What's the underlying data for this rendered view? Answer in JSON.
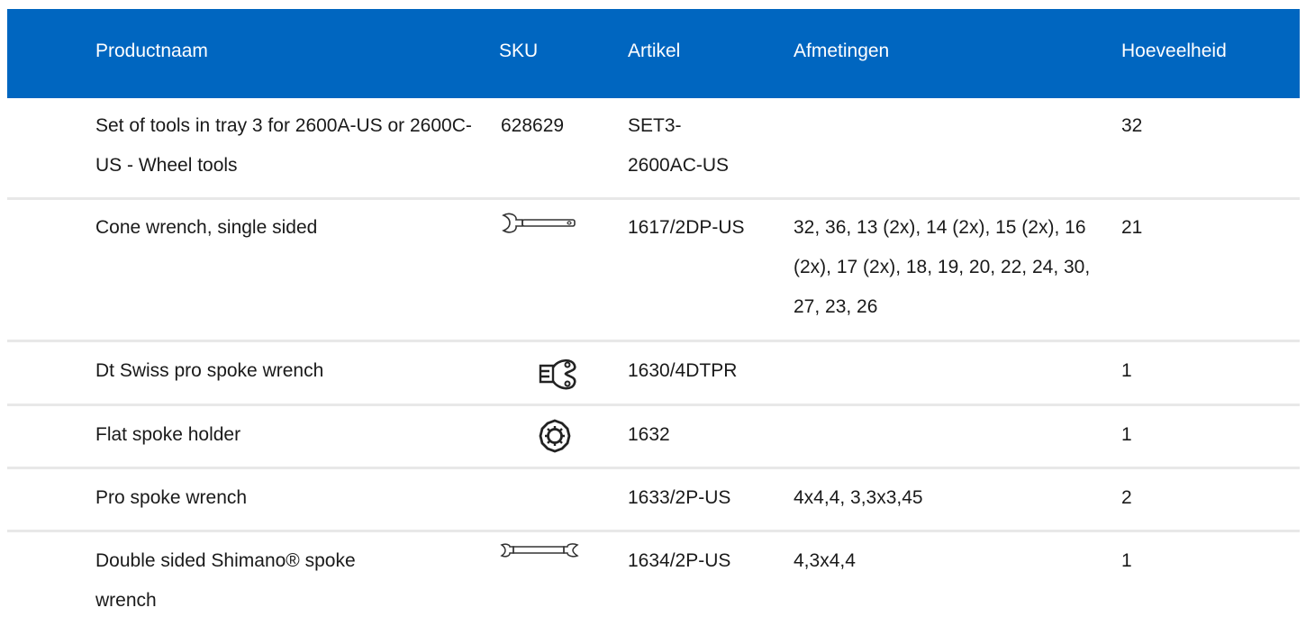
{
  "table": {
    "headers": {
      "name": "Productnaam",
      "sku": "SKU",
      "article": "Artikel",
      "dimensions": "Afmetingen",
      "quantity": "Hoeveelheid"
    },
    "rows": [
      {
        "name": "Set of tools in tray 3 for 2600A-US or 2600C-US - Wheel tools",
        "sku": "628629",
        "article": "SET3-2600AC-US",
        "dimensions": "",
        "quantity": "32",
        "icon": ""
      },
      {
        "name": "Cone wrench, single sided",
        "sku": "",
        "article": "1617/2DP-US",
        "dimensions": "32, 36, 13 (2x), 14 (2x), 15 (2x), 16 (2x), 17 (2x), 18, 19, 20, 22, 24, 30, 27, 23, 26",
        "quantity": "21",
        "icon": "cone-wrench-icon"
      },
      {
        "name": "Dt Swiss pro spoke wrench",
        "sku": "",
        "article": "1630/4DTPR",
        "dimensions": "",
        "quantity": "1",
        "icon": "dt-swiss-spoke-wrench-icon"
      },
      {
        "name": "Flat spoke holder",
        "sku": "",
        "article": "1632",
        "dimensions": "",
        "quantity": "1",
        "icon": "flat-spoke-holder-icon"
      },
      {
        "name": "Pro spoke wrench",
        "sku": "",
        "article": "1633/2P-US",
        "dimensions": "4x4,4, 3,3x3,45",
        "quantity": "2",
        "icon": ""
      },
      {
        "name": "Double sided Shimano® spoke wrench",
        "sku": "",
        "article": "1634/2P-US",
        "dimensions": "4,3x4,4",
        "quantity": "1",
        "icon": "double-sided-spoke-wrench-icon"
      }
    ]
  },
  "colors": {
    "header_bg": "#0066c0",
    "header_text": "#ffffff",
    "separator": "#e8e8e8"
  }
}
